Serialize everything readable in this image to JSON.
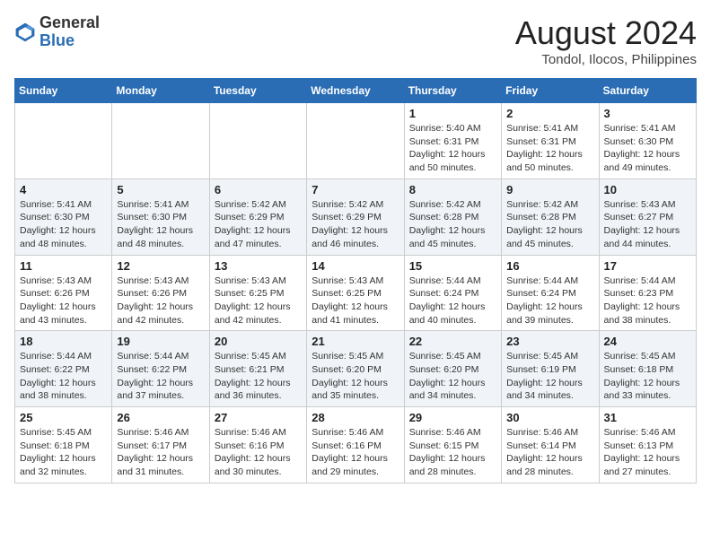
{
  "header": {
    "logo_line1": "General",
    "logo_line2": "Blue",
    "title": "August 2024",
    "subtitle": "Tondol, Ilocos, Philippines"
  },
  "weekdays": [
    "Sunday",
    "Monday",
    "Tuesday",
    "Wednesday",
    "Thursday",
    "Friday",
    "Saturday"
  ],
  "weeks": [
    [
      {
        "day": "",
        "info": ""
      },
      {
        "day": "",
        "info": ""
      },
      {
        "day": "",
        "info": ""
      },
      {
        "day": "",
        "info": ""
      },
      {
        "day": "1",
        "info": "Sunrise: 5:40 AM\nSunset: 6:31 PM\nDaylight: 12 hours\nand 50 minutes."
      },
      {
        "day": "2",
        "info": "Sunrise: 5:41 AM\nSunset: 6:31 PM\nDaylight: 12 hours\nand 50 minutes."
      },
      {
        "day": "3",
        "info": "Sunrise: 5:41 AM\nSunset: 6:30 PM\nDaylight: 12 hours\nand 49 minutes."
      }
    ],
    [
      {
        "day": "4",
        "info": "Sunrise: 5:41 AM\nSunset: 6:30 PM\nDaylight: 12 hours\nand 48 minutes."
      },
      {
        "day": "5",
        "info": "Sunrise: 5:41 AM\nSunset: 6:30 PM\nDaylight: 12 hours\nand 48 minutes."
      },
      {
        "day": "6",
        "info": "Sunrise: 5:42 AM\nSunset: 6:29 PM\nDaylight: 12 hours\nand 47 minutes."
      },
      {
        "day": "7",
        "info": "Sunrise: 5:42 AM\nSunset: 6:29 PM\nDaylight: 12 hours\nand 46 minutes."
      },
      {
        "day": "8",
        "info": "Sunrise: 5:42 AM\nSunset: 6:28 PM\nDaylight: 12 hours\nand 45 minutes."
      },
      {
        "day": "9",
        "info": "Sunrise: 5:42 AM\nSunset: 6:28 PM\nDaylight: 12 hours\nand 45 minutes."
      },
      {
        "day": "10",
        "info": "Sunrise: 5:43 AM\nSunset: 6:27 PM\nDaylight: 12 hours\nand 44 minutes."
      }
    ],
    [
      {
        "day": "11",
        "info": "Sunrise: 5:43 AM\nSunset: 6:26 PM\nDaylight: 12 hours\nand 43 minutes."
      },
      {
        "day": "12",
        "info": "Sunrise: 5:43 AM\nSunset: 6:26 PM\nDaylight: 12 hours\nand 42 minutes."
      },
      {
        "day": "13",
        "info": "Sunrise: 5:43 AM\nSunset: 6:25 PM\nDaylight: 12 hours\nand 42 minutes."
      },
      {
        "day": "14",
        "info": "Sunrise: 5:43 AM\nSunset: 6:25 PM\nDaylight: 12 hours\nand 41 minutes."
      },
      {
        "day": "15",
        "info": "Sunrise: 5:44 AM\nSunset: 6:24 PM\nDaylight: 12 hours\nand 40 minutes."
      },
      {
        "day": "16",
        "info": "Sunrise: 5:44 AM\nSunset: 6:24 PM\nDaylight: 12 hours\nand 39 minutes."
      },
      {
        "day": "17",
        "info": "Sunrise: 5:44 AM\nSunset: 6:23 PM\nDaylight: 12 hours\nand 38 minutes."
      }
    ],
    [
      {
        "day": "18",
        "info": "Sunrise: 5:44 AM\nSunset: 6:22 PM\nDaylight: 12 hours\nand 38 minutes."
      },
      {
        "day": "19",
        "info": "Sunrise: 5:44 AM\nSunset: 6:22 PM\nDaylight: 12 hours\nand 37 minutes."
      },
      {
        "day": "20",
        "info": "Sunrise: 5:45 AM\nSunset: 6:21 PM\nDaylight: 12 hours\nand 36 minutes."
      },
      {
        "day": "21",
        "info": "Sunrise: 5:45 AM\nSunset: 6:20 PM\nDaylight: 12 hours\nand 35 minutes."
      },
      {
        "day": "22",
        "info": "Sunrise: 5:45 AM\nSunset: 6:20 PM\nDaylight: 12 hours\nand 34 minutes."
      },
      {
        "day": "23",
        "info": "Sunrise: 5:45 AM\nSunset: 6:19 PM\nDaylight: 12 hours\nand 34 minutes."
      },
      {
        "day": "24",
        "info": "Sunrise: 5:45 AM\nSunset: 6:18 PM\nDaylight: 12 hours\nand 33 minutes."
      }
    ],
    [
      {
        "day": "25",
        "info": "Sunrise: 5:45 AM\nSunset: 6:18 PM\nDaylight: 12 hours\nand 32 minutes."
      },
      {
        "day": "26",
        "info": "Sunrise: 5:46 AM\nSunset: 6:17 PM\nDaylight: 12 hours\nand 31 minutes."
      },
      {
        "day": "27",
        "info": "Sunrise: 5:46 AM\nSunset: 6:16 PM\nDaylight: 12 hours\nand 30 minutes."
      },
      {
        "day": "28",
        "info": "Sunrise: 5:46 AM\nSunset: 6:16 PM\nDaylight: 12 hours\nand 29 minutes."
      },
      {
        "day": "29",
        "info": "Sunrise: 5:46 AM\nSunset: 6:15 PM\nDaylight: 12 hours\nand 28 minutes."
      },
      {
        "day": "30",
        "info": "Sunrise: 5:46 AM\nSunset: 6:14 PM\nDaylight: 12 hours\nand 28 minutes."
      },
      {
        "day": "31",
        "info": "Sunrise: 5:46 AM\nSunset: 6:13 PM\nDaylight: 12 hours\nand 27 minutes."
      }
    ]
  ]
}
